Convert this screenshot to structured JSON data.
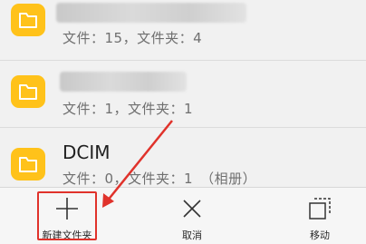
{
  "folders": [
    {
      "name": "",
      "meta": "文件：15，文件夹：4"
    },
    {
      "name": "",
      "meta": "文件：1，文件夹：1"
    },
    {
      "name": "DCIM",
      "meta": "文件：0，文件夹：1　（相册）"
    }
  ],
  "toolbar": {
    "new_folder_label": "新建文件夹",
    "cancel_label": "取消",
    "move_label": "移动"
  },
  "colors": {
    "folder_yellow": "#ffc21a",
    "annotation_red": "#e0322b"
  }
}
